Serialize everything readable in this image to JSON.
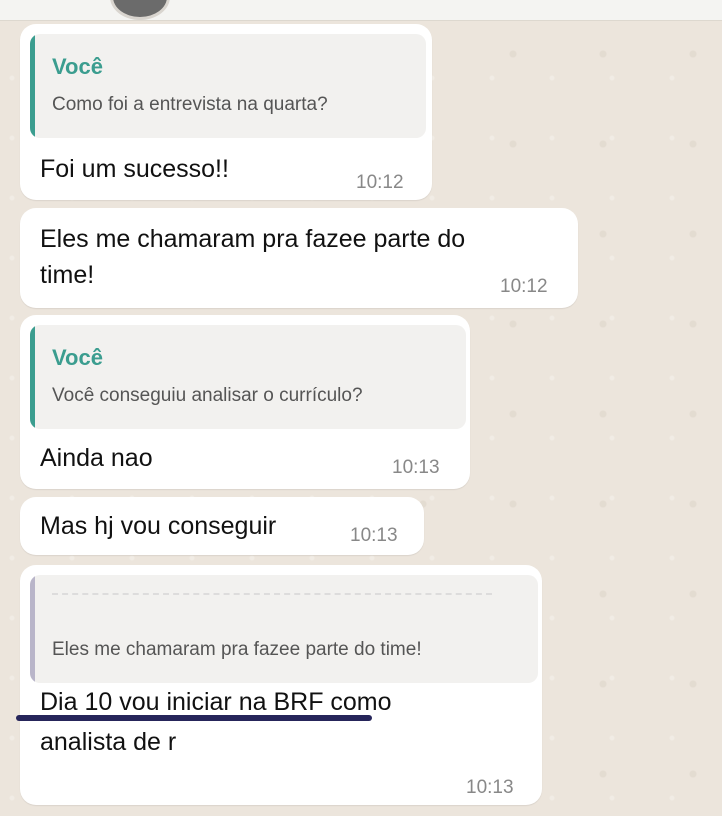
{
  "chat": {
    "messages": [
      {
        "quote_author": "Você",
        "quote_text": "Como foi a entrevista na quarta?",
        "text": "Foi um sucesso!!",
        "time": "10:12"
      },
      {
        "text_line1": "Eles me chamaram pra fazee parte do",
        "text_line2": "time!",
        "time": "10:12"
      },
      {
        "quote_author": "Você",
        "quote_text": "Você conseguiu analisar o currículo?",
        "text": "Ainda nao",
        "time": "10:13"
      },
      {
        "text": "Mas hj vou conseguir",
        "time": "10:13"
      },
      {
        "quote_text": "Eles me chamaram pra fazee parte do time!",
        "text_line1": "Dia 10 vou iniciar na BRF como",
        "text_line2": "analista de r",
        "time": "10:13"
      }
    ]
  },
  "colors": {
    "quote_accent_self": "#3b9d8f",
    "quote_accent_other": "#b9b5c9",
    "underline": "#26255a"
  }
}
